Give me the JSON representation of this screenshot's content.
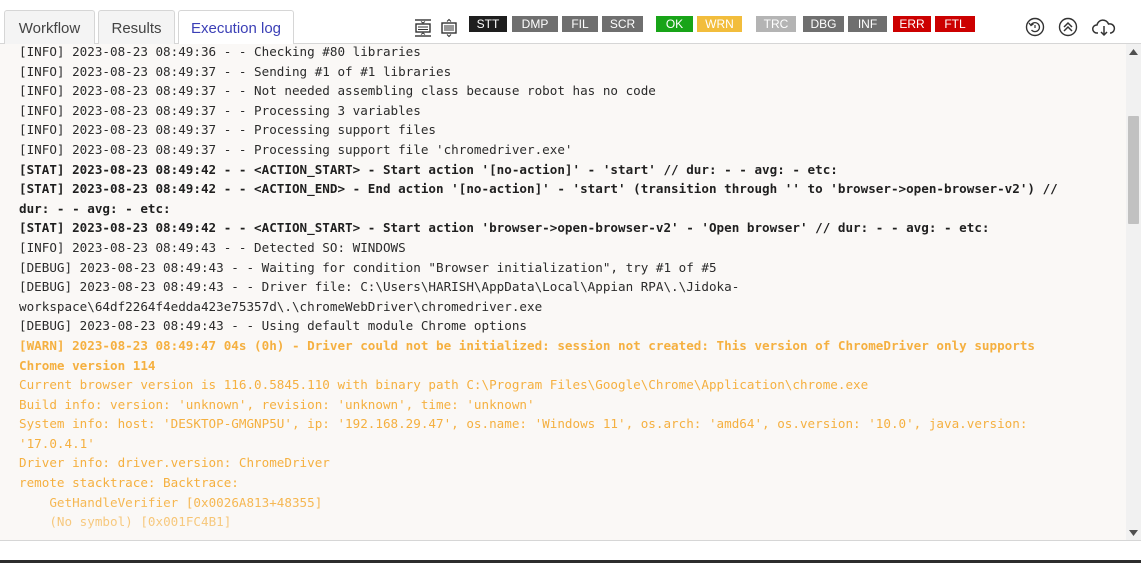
{
  "tabs": {
    "workflow": "Workflow",
    "results": "Results",
    "execution_log": "Execution log"
  },
  "filters": [
    {
      "label": "STT",
      "color": "#1e1e1e"
    },
    {
      "label": "DMP",
      "color": "#6f6f6f"
    },
    {
      "label": "FIL",
      "color": "#6f6f6f"
    },
    {
      "label": "SCR",
      "color": "#6f6f6f"
    },
    {
      "label": "OK",
      "color": "#18a418"
    },
    {
      "label": "WRN",
      "color": "#f2bd3c"
    },
    {
      "label": "TRC",
      "color": "#b4b4b4"
    },
    {
      "label": "DBG",
      "color": "#6f6f6f"
    },
    {
      "label": "INF",
      "color": "#6f6f6f"
    },
    {
      "label": "ERR",
      "color": "#cc0000"
    },
    {
      "label": "FTL",
      "color": "#cc0000"
    }
  ],
  "log": [
    {
      "level": "info",
      "text": "[INFO] 2023-08-23 08:49:36 - - Checking #80 libraries"
    },
    {
      "level": "info",
      "text": "[INFO] 2023-08-23 08:49:37 - - Sending #1 of #1 libraries"
    },
    {
      "level": "info",
      "text": "[INFO] 2023-08-23 08:49:37 - - Not needed assembling class because robot has no code"
    },
    {
      "level": "info",
      "text": "[INFO] 2023-08-23 08:49:37 - - Processing 3 variables"
    },
    {
      "level": "info",
      "text": "[INFO] 2023-08-23 08:49:37 - - Processing support files"
    },
    {
      "level": "info",
      "text": "[INFO] 2023-08-23 08:49:37 - - Processing support file 'chromedriver.exe'"
    },
    {
      "level": "stat",
      "text": "[STAT] 2023-08-23 08:49:42 - - <ACTION_START> - Start action '[no-action]' - 'start' // dur: - - avg: - etc:"
    },
    {
      "level": "stat",
      "text": "[STAT] 2023-08-23 08:49:42 - - <ACTION_END> - End action '[no-action]' - 'start' (transition through '' to 'browser->open-browser-v2') //"
    },
    {
      "level": "stat",
      "text": "dur: - - avg: - etc:"
    },
    {
      "level": "stat",
      "text": "[STAT] 2023-08-23 08:49:42 - - <ACTION_START> - Start action 'browser->open-browser-v2' - 'Open browser' // dur: - - avg: - etc:"
    },
    {
      "level": "info",
      "text": "[INFO] 2023-08-23 08:49:43 - - Detected SO: WINDOWS"
    },
    {
      "level": "info",
      "text": "[DEBUG] 2023-08-23 08:49:43 - - Waiting for condition \"Browser initialization\", try #1 of #5"
    },
    {
      "level": "info",
      "text": "[DEBUG] 2023-08-23 08:49:43 - - Driver file: C:\\Users\\HARISH\\AppData\\Local\\Appian RPA\\.\\Jidoka-"
    },
    {
      "level": "info",
      "text": "workspace\\64df2264f4edda423e75357d\\.\\chromeWebDriver\\chromedriver.exe"
    },
    {
      "level": "info",
      "text": "[DEBUG] 2023-08-23 08:49:43 - - Using default module Chrome options"
    },
    {
      "level": "warn-bold",
      "text": "[WARN] 2023-08-23 08:49:47 04s (0h) - Driver could not be initialized: session not created: This version of ChromeDriver only supports"
    },
    {
      "level": "warn-bold",
      "text": "Chrome version 114"
    },
    {
      "level": "warn",
      "text": "Current browser version is 116.0.5845.110 with binary path C:\\Program Files\\Google\\Chrome\\Application\\chrome.exe"
    },
    {
      "level": "warn",
      "text": "Build info: version: 'unknown', revision: 'unknown', time: 'unknown'"
    },
    {
      "level": "warn",
      "text": "System info: host: 'DESKTOP-GMGNP5U', ip: '192.168.29.47', os.name: 'Windows 11', os.arch: 'amd64', os.version: '10.0', java.version:"
    },
    {
      "level": "warn",
      "text": "'17.0.4.1'"
    },
    {
      "level": "warn",
      "text": "Driver info: driver.version: ChromeDriver"
    },
    {
      "level": "warn",
      "text": "remote stacktrace: Backtrace:"
    },
    {
      "level": "warn",
      "text": "    GetHandleVerifier [0x0026A813+48355]"
    },
    {
      "level": "warn",
      "text": "    (No symbol) [0x001FC4B1]"
    }
  ]
}
